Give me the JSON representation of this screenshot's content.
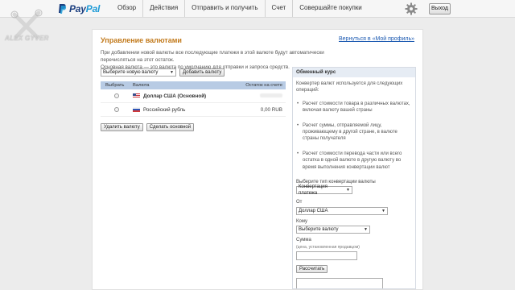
{
  "header": {
    "logo_pay": "Pay",
    "logo_pal": "Pal",
    "nav": [
      "Обзор",
      "Действия",
      "Отправить и получить",
      "Счет",
      "Совершайте покупки"
    ],
    "logout": "Выход"
  },
  "watermark": {
    "text": "ALEX GYVER"
  },
  "page": {
    "title": "Управление валютами",
    "back_link": "Вернуться в «Мой профиль»",
    "intro_line1": "При добавлении новой валюты все последующие платежи в этой валюте будут автоматически перечисляться на этот остаток.",
    "intro_line2": "Основная валюта — это валюта по умолчанию для отправки и запроса средств."
  },
  "controls": {
    "select_currency": "Выберите новую валюту",
    "add_button": "Добавить валюту"
  },
  "table": {
    "headers": [
      "Выбрать",
      "Валюта",
      "Остаток на счете"
    ],
    "rows": [
      {
        "currency": "Доллар США (Основной)",
        "balance": "",
        "flag": "us"
      },
      {
        "currency": "Российский рубль",
        "balance": "0,00 RUB",
        "flag": "ru"
      }
    ]
  },
  "table_buttons": {
    "remove": "Удалить валюту",
    "make_primary": "Сделать основной"
  },
  "converter": {
    "heading": "Обменный курс",
    "description": "Конвертер валют используется для следующих операций:",
    "bullets": [
      "Расчет стоимости товара в различных валютах, включая валюту вашей страны",
      "Расчет суммы, отправляемой лицу, проживающему в другой стране, в валюте страны получателя",
      "Расчет стоимости перевода части или всего остатка в одной валюте в другую валюту во время выполнения конвертации валют"
    ],
    "type_label": "Выберите тип конвертации валюты",
    "type_value": "Конвертация платежа",
    "from_label": "От",
    "from_value": "Доллар США",
    "to_label": "Кому",
    "to_value": "Выберите валюту",
    "sum_label": "Сумма",
    "sum_hint": "(цена, установленная продавцом)",
    "calc_button": "Рассчитать"
  }
}
